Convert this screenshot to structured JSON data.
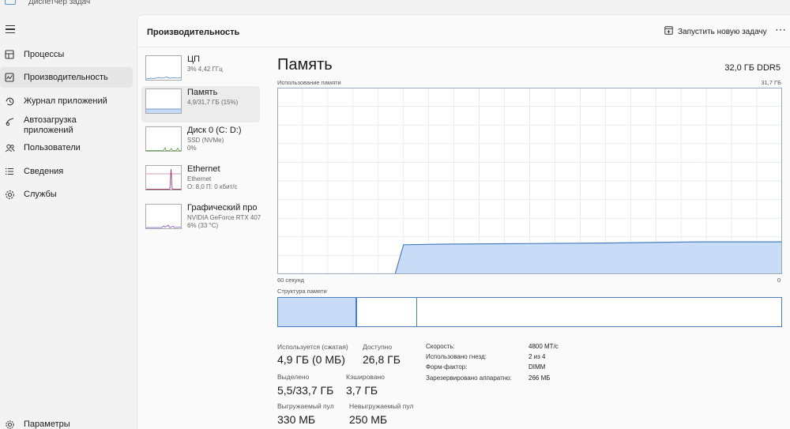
{
  "window": {
    "title": "Диспетчер задач"
  },
  "nav": {
    "items": [
      {
        "label": "Процессы",
        "icon": "processes-icon"
      },
      {
        "label": "Производительность",
        "icon": "performance-icon",
        "active": true
      },
      {
        "label": "Журнал приложений",
        "icon": "history-icon"
      },
      {
        "label_line1": "Автозагрузка",
        "label_line2": "приложений",
        "icon": "startup-icon"
      },
      {
        "label": "Пользователи",
        "icon": "users-icon"
      },
      {
        "label": "Сведения",
        "icon": "details-icon"
      },
      {
        "label": "Службы",
        "icon": "services-icon"
      }
    ],
    "settings": "Параметры"
  },
  "header": {
    "title": "Производительность",
    "run_task": "Запустить новую задачу",
    "more": "⋯"
  },
  "resources": [
    {
      "name": "ЦП",
      "sub1": "3% 4,42 ГГц",
      "sub2": "",
      "color": "#4a7ec4"
    },
    {
      "name": "Память",
      "sub1": "4,9/31,7 ГБ (15%)",
      "sub2": "",
      "color": "#4a7ec4",
      "active": true
    },
    {
      "name": "Диск 0 (C: D:)",
      "sub1": "SSD (NVMe)",
      "sub2": "0%",
      "color": "#4c9a2a"
    },
    {
      "name": "Ethernet",
      "sub1": "Ethernet",
      "sub2": "О: 8,0 П: 0 кбит/с",
      "color": "#a43d6b"
    },
    {
      "name": "Графический про",
      "sub1": "NVIDIA GeForce RTX 407",
      "sub2": "6% (33 °C)",
      "color": "#7a4fc8"
    }
  ],
  "memory": {
    "title": "Память",
    "total": "32,0 ГБ DDR5",
    "usage_label": "Использование памяти",
    "usage_max": "31,7 ГБ",
    "axis_left": "60 секунд",
    "axis_right": "0",
    "structure_label": "Структура памяти",
    "colors": {
      "line": "#4a7ec4",
      "fill": "#c9dcf7",
      "grid": "#dbe6f3"
    }
  },
  "chart_data": {
    "type": "area",
    "title": "Использование памяти",
    "xlabel": "",
    "ylabel": "",
    "x": [
      60,
      53,
      47,
      46,
      45,
      40,
      30,
      20,
      10,
      5,
      0
    ],
    "values": [
      0,
      0,
      0,
      0,
      5.0,
      5.1,
      5.2,
      5.3,
      5.5,
      5.5,
      5.5
    ],
    "xlim": [
      60,
      0
    ],
    "ylim": [
      0,
      31.7
    ],
    "grid": true
  },
  "stats": {
    "in_use_label": "Используется (сжатая)",
    "in_use_value": "4,9 ГБ (0 МБ)",
    "available_label": "Доступно",
    "available_value": "26,8 ГБ",
    "committed_label": "Выделено",
    "committed_value": "5,5/33,7 ГБ",
    "cached_label": "Кэшировано",
    "cached_value": "3,7 ГБ",
    "paged_label": "Выгружаемый пул",
    "paged_value": "330 МБ",
    "nonpaged_label": "Невыгружаемый пул",
    "nonpaged_value": "250 МБ"
  },
  "specs": [
    {
      "key": "Скорость:",
      "value": "4800 МТ/с"
    },
    {
      "key": "Использовано гнезд:",
      "value": "2 из 4"
    },
    {
      "key": "Форм-фактор:",
      "value": "DIMM"
    },
    {
      "key": "Зарезервировано аппаратно:",
      "value": "266 МБ"
    }
  ]
}
